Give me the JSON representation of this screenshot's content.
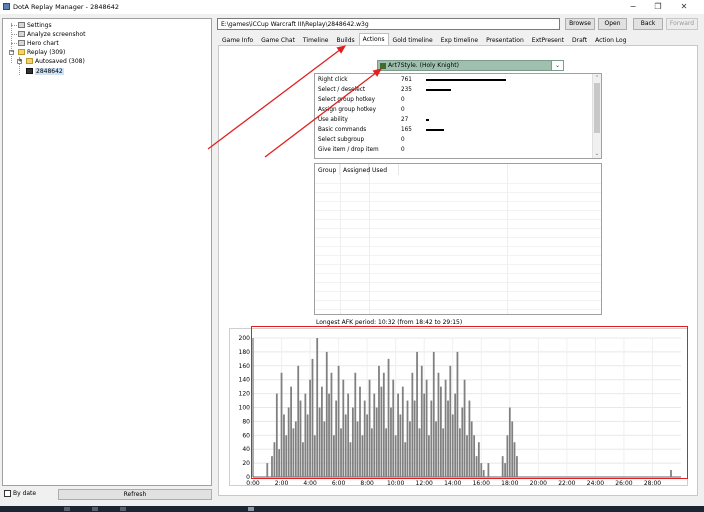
{
  "window": {
    "title": "DotA Replay Manager - 2848642",
    "minimize": "−",
    "maximize": "❐",
    "close": "✕"
  },
  "tree": {
    "settings": "Settings",
    "analyze": "Analyze screenshot",
    "hero_chart": "Hero chart",
    "replay": "Replay (309)",
    "autosaved": "Autosaved (308)",
    "file": "2848642"
  },
  "bottom_left": {
    "by_date": "By date",
    "refresh": "Refresh"
  },
  "toolbar": {
    "path": "E:\\games\\iCCup Warcraft III\\Replay\\2848642.w3g",
    "browse": "Browse",
    "open": "Open",
    "back": "Back",
    "forward": "Forward"
  },
  "tabs": [
    "Game Info",
    "Game Chat",
    "Timeline",
    "Builds",
    "Actions",
    "Gold timeline",
    "Exp timeline",
    "Presentation",
    "ExtPresent",
    "Draft",
    "Action Log"
  ],
  "active_tab": "Actions",
  "player": "Art7Style. (Holy Knight)",
  "actions": [
    {
      "name": "Right click",
      "count": "761"
    },
    {
      "name": "Select / deselect",
      "count": "235"
    },
    {
      "name": "Select group hotkey",
      "count": "0"
    },
    {
      "name": "Assign group hotkey",
      "count": "0"
    },
    {
      "name": "Use ability",
      "count": "27"
    },
    {
      "name": "Basic commands",
      "count": "165"
    },
    {
      "name": "Select subgroup",
      "count": "0"
    },
    {
      "name": "Give item / drop item",
      "count": "0"
    }
  ],
  "groups_header": {
    "group": "Group",
    "assigned": "Assigned",
    "used": "Used"
  },
  "afk": "Longest AFK period: 10:32 (from 18:42 to 29:15)",
  "chart_data": {
    "type": "bar",
    "title": "",
    "xlabel": "",
    "ylabel": "",
    "ylim": [
      0,
      200
    ],
    "yticks": [
      "0",
      "20",
      "40",
      "60",
      "80",
      "100",
      "120",
      "140",
      "160",
      "180",
      "200"
    ],
    "xticks": [
      "0:00",
      "2:00",
      "4:00",
      "6:00",
      "8:00",
      "10:00",
      "12:00",
      "14:00",
      "16:00",
      "18:00",
      "20:00",
      "22:00",
      "24:00",
      "26:00",
      "28:00"
    ],
    "grid": true,
    "bar_color": "#808080",
    "x_minutes": [
      1.0,
      1.17,
      1.33,
      1.5,
      1.67,
      1.83,
      2.0,
      2.17,
      2.33,
      2.5,
      2.67,
      2.83,
      3.0,
      3.17,
      3.33,
      3.5,
      3.67,
      3.83,
      4.0,
      4.17,
      4.33,
      4.5,
      4.67,
      4.83,
      5.0,
      5.17,
      5.33,
      5.5,
      5.67,
      5.83,
      6.0,
      6.17,
      6.33,
      6.5,
      6.67,
      6.83,
      7.0,
      7.17,
      7.33,
      7.5,
      7.67,
      7.83,
      8.0,
      8.17,
      8.33,
      8.5,
      8.67,
      8.83,
      9.0,
      9.17,
      9.33,
      9.5,
      9.67,
      9.83,
      10.0,
      10.17,
      10.33,
      10.5,
      10.67,
      10.83,
      11.0,
      11.17,
      11.33,
      11.5,
      11.67,
      11.83,
      12.0,
      12.17,
      12.33,
      12.5,
      12.67,
      12.83,
      13.0,
      13.17,
      13.33,
      13.5,
      13.67,
      13.83,
      14.0,
      14.17,
      14.33,
      14.5,
      14.67,
      14.83,
      15.0,
      15.17,
      15.33,
      15.5,
      15.67,
      15.83,
      16.0,
      16.17,
      16.33,
      16.5,
      16.67,
      16.83,
      17.0,
      17.17,
      17.33,
      17.5,
      17.67,
      17.83,
      18.0,
      18.17,
      18.33,
      18.5,
      29.3
    ],
    "values": [
      20,
      0,
      30,
      50,
      120,
      40,
      150,
      90,
      60,
      100,
      130,
      70,
      80,
      160,
      110,
      50,
      120,
      90,
      140,
      170,
      60,
      200,
      100,
      130,
      80,
      180,
      120,
      150,
      60,
      110,
      160,
      70,
      140,
      90,
      120,
      50,
      100,
      150,
      80,
      130,
      60,
      110,
      90,
      140,
      70,
      120,
      100,
      160,
      130,
      150,
      70,
      170,
      100,
      140,
      60,
      120,
      90,
      130,
      50,
      110,
      80,
      150,
      110,
      180,
      70,
      160,
      120,
      140,
      60,
      110,
      180,
      80,
      150,
      130,
      70,
      140,
      110,
      160,
      90,
      120,
      180,
      70,
      100,
      140,
      60,
      110,
      80,
      60,
      30,
      50,
      20,
      10,
      0,
      20,
      0,
      0,
      0,
      0,
      0,
      30,
      20,
      60,
      100,
      80,
      50,
      30,
      10
    ]
  }
}
